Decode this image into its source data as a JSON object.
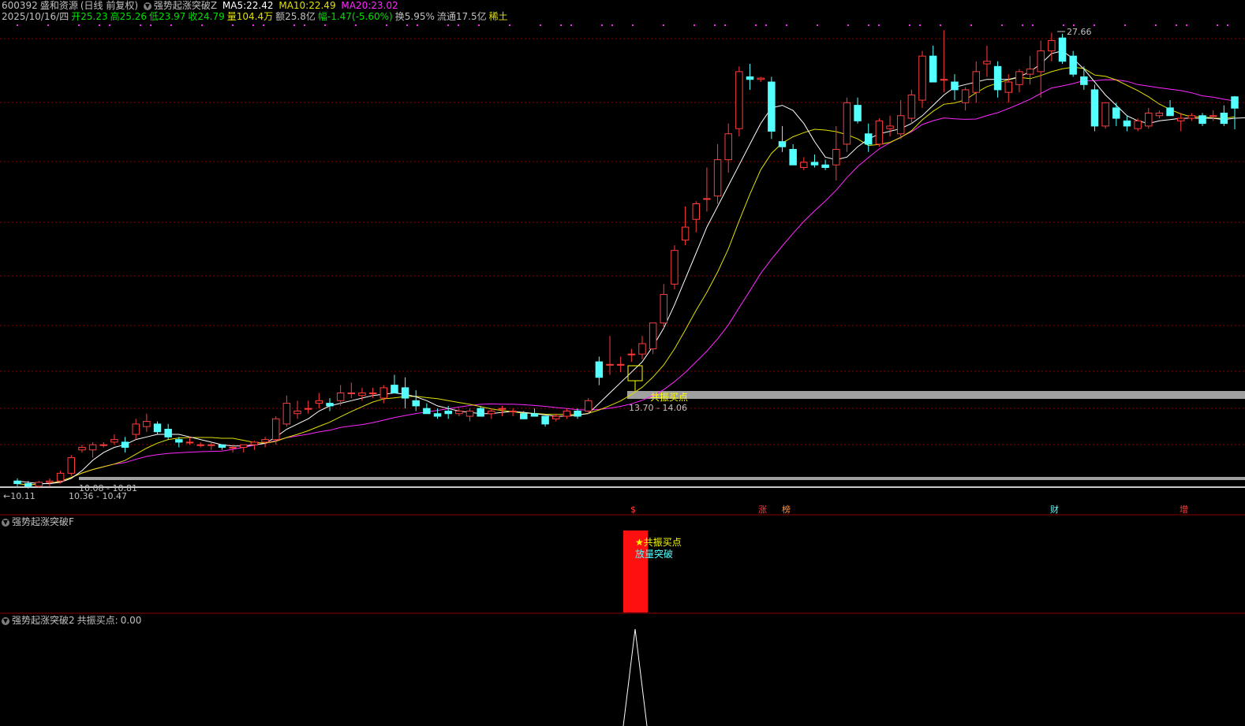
{
  "header": {
    "code": "600392",
    "name": "盛和资源",
    "period": "(日线 前复权)",
    "indicator": "强势起涨突破Z",
    "ma5_label": "MA5:",
    "ma5_value": "22.42",
    "ma10_label": "MA10:",
    "ma10_value": "22.49",
    "ma20_label": "MA20:",
    "ma20_value": "23.02",
    "date": "2025/10/16/四",
    "open_label": "开",
    "open_value": "25.23",
    "high_label": "高",
    "high_value": "25.26",
    "low_label": "低",
    "low_value": "23.97",
    "close_label": "收",
    "close_value": "24.79",
    "vol_label": "量",
    "vol_value": "104.4万",
    "amount_label": "额",
    "amount_value": "25.8亿",
    "amp_label": "幅",
    "amp_value": "-1.47(-5.60%)",
    "turnover_label": "换",
    "turnover_value": "5.95%",
    "float_label": "流通",
    "float_value": "17.5亿",
    "sector": "稀土"
  },
  "colors": {
    "up": "#ff3c3c",
    "down": "#54ffff",
    "ma5": "#ffffff",
    "ma10": "#e0e000",
    "ma20": "#ff28ff",
    "grid": "#8c0000",
    "band": "#a0a0a0"
  },
  "main_labels": {
    "peak": "27.66",
    "left_low": "10.11",
    "range1": "10.08 - 10.81",
    "range2": "10.36 - 10.47",
    "signal": "共振买点",
    "signal_range": "13.70 - 14.06"
  },
  "event_markers": [
    {
      "text": "$",
      "color": "#ff3c3c"
    },
    {
      "text": "涨",
      "color": "#ff3c3c"
    },
    {
      "text": "榜",
      "color": "#ff9040"
    },
    {
      "text": "财",
      "color": "#54ffff"
    },
    {
      "text": "增",
      "color": "#ff3c3c"
    }
  ],
  "panel_f": {
    "title": "强势起涨突破F",
    "signal_label": "★共振买点",
    "signal_label2": "放量突破"
  },
  "panel_2": {
    "title": "强势起涨突破2",
    "value_label": "共振买点:",
    "value": "0.00"
  },
  "chart_data": {
    "type": "candlestick",
    "ohlc": [
      [
        10.4,
        10.5,
        10.2,
        10.3
      ],
      [
        10.3,
        10.4,
        10.11,
        10.2
      ],
      [
        10.2,
        10.4,
        10.15,
        10.35
      ],
      [
        10.35,
        10.5,
        10.2,
        10.4
      ],
      [
        10.4,
        10.8,
        10.3,
        10.7
      ],
      [
        10.7,
        11.4,
        10.6,
        11.3
      ],
      [
        11.6,
        11.8,
        11.5,
        11.7
      ],
      [
        11.6,
        11.9,
        11.3,
        11.8
      ],
      [
        11.8,
        11.9,
        11.7,
        11.8
      ],
      [
        11.9,
        12.2,
        11.8,
        12.0
      ],
      [
        11.9,
        12.1,
        11.5,
        11.7
      ],
      [
        12.2,
        12.8,
        12.0,
        12.6
      ],
      [
        12.5,
        13.0,
        12.3,
        12.7
      ],
      [
        12.6,
        12.7,
        12.2,
        12.3
      ],
      [
        12.4,
        12.6,
        12.0,
        12.1
      ],
      [
        12.0,
        12.1,
        11.7,
        11.9
      ],
      [
        11.9,
        12.1,
        11.8,
        11.9
      ],
      [
        11.8,
        11.9,
        11.7,
        11.8
      ],
      [
        11.8,
        11.9,
        11.6,
        11.8
      ],
      [
        11.8,
        11.8,
        11.6,
        11.7
      ],
      [
        11.7,
        11.8,
        11.5,
        11.7
      ],
      [
        11.7,
        11.8,
        11.5,
        11.8
      ],
      [
        11.8,
        11.95,
        11.6,
        11.9
      ],
      [
        11.9,
        12.1,
        11.7,
        12.0
      ],
      [
        12.0,
        12.9,
        11.8,
        12.8
      ],
      [
        12.6,
        13.7,
        12.5,
        13.4
      ],
      [
        13.0,
        13.5,
        12.8,
        13.1
      ],
      [
        13.2,
        13.5,
        13.0,
        13.2
      ],
      [
        13.4,
        13.8,
        13.2,
        13.5
      ],
      [
        13.4,
        13.6,
        13.1,
        13.3
      ],
      [
        13.5,
        14.1,
        13.3,
        13.8
      ],
      [
        13.8,
        14.2,
        13.6,
        13.8
      ],
      [
        13.7,
        14.0,
        13.5,
        13.8
      ],
      [
        13.8,
        14.0,
        13.6,
        13.8
      ],
      [
        13.6,
        14.1,
        13.4,
        14.0
      ],
      [
        14.1,
        14.5,
        13.8,
        13.8
      ],
      [
        14.0,
        14.4,
        13.2,
        13.6
      ],
      [
        13.5,
        13.9,
        13.1,
        13.3
      ],
      [
        13.2,
        13.4,
        13.0,
        13.0
      ],
      [
        13.0,
        13.2,
        12.8,
        12.9
      ],
      [
        13.1,
        13.3,
        12.8,
        13.0
      ],
      [
        13.0,
        13.2,
        12.9,
        13.1
      ],
      [
        12.9,
        13.2,
        12.7,
        13.1
      ],
      [
        13.2,
        13.3,
        12.9,
        12.9
      ],
      [
        13.0,
        13.2,
        12.8,
        13.1
      ],
      [
        13.2,
        13.3,
        12.9,
        13.2
      ],
      [
        13.1,
        13.2,
        12.9,
        13.1
      ],
      [
        13.0,
        13.1,
        12.8,
        12.8
      ],
      [
        13.0,
        13.2,
        12.9,
        12.9
      ],
      [
        12.9,
        12.9,
        12.5,
        12.6
      ],
      [
        12.8,
        13.0,
        12.7,
        12.9
      ],
      [
        12.9,
        13.2,
        12.8,
        13.1
      ],
      [
        13.1,
        13.2,
        12.8,
        12.9
      ],
      [
        13.1,
        13.6,
        13.0,
        13.5
      ],
      [
        15.0,
        15.2,
        14.1,
        14.4
      ],
      [
        14.9,
        16.0,
        14.5,
        14.9
      ],
      [
        14.9,
        15.2,
        14.6,
        14.9
      ],
      [
        15.3,
        15.5,
        15.0,
        15.3
      ],
      [
        15.3,
        16.0,
        15.1,
        15.7
      ],
      [
        15.5,
        16.5,
        15.3,
        16.5
      ],
      [
        16.5,
        18.0,
        16.3,
        17.6
      ],
      [
        18.0,
        19.5,
        17.8,
        19.3
      ],
      [
        19.7,
        21.0,
        19.5,
        20.2
      ],
      [
        20.5,
        21.2,
        20.0,
        21.1
      ],
      [
        21.3,
        22.5,
        20.8,
        21.3
      ],
      [
        21.4,
        23.4,
        21.1,
        22.8
      ],
      [
        22.8,
        24.2,
        22.3,
        23.8
      ],
      [
        24.0,
        26.4,
        23.7,
        26.2
      ],
      [
        26.0,
        26.5,
        25.5,
        25.9
      ],
      [
        25.9,
        26.0,
        25.8,
        25.95
      ],
      [
        25.8,
        26.0,
        23.6,
        23.9
      ],
      [
        23.5,
        24.1,
        23.1,
        23.3
      ],
      [
        23.2,
        23.4,
        22.6,
        22.6
      ],
      [
        22.5,
        22.9,
        22.4,
        22.7
      ],
      [
        22.7,
        23.0,
        22.5,
        22.6
      ],
      [
        22.6,
        22.8,
        22.4,
        22.5
      ],
      [
        22.6,
        24.1,
        22.0,
        23.2
      ],
      [
        23.4,
        25.2,
        23.1,
        25.0
      ],
      [
        24.9,
        25.2,
        24.2,
        24.3
      ],
      [
        23.8,
        24.2,
        23.1,
        23.4
      ],
      [
        23.4,
        24.4,
        23.3,
        24.3
      ],
      [
        24.0,
        24.5,
        23.7,
        24.1
      ],
      [
        23.8,
        25.1,
        23.6,
        24.5
      ],
      [
        24.4,
        25.5,
        24.2,
        25.3
      ],
      [
        25.1,
        27.0,
        24.8,
        26.8
      ],
      [
        26.8,
        27.2,
        25.8,
        25.8
      ],
      [
        25.9,
        27.8,
        25.4,
        25.9
      ],
      [
        25.8,
        26.1,
        25.1,
        25.5
      ],
      [
        25.0,
        25.6,
        24.7,
        25.5
      ],
      [
        25.4,
        26.6,
        25.0,
        26.2
      ],
      [
        26.5,
        27.2,
        26.0,
        26.6
      ],
      [
        26.4,
        26.6,
        25.2,
        25.5
      ],
      [
        25.4,
        26.1,
        25.0,
        25.8
      ],
      [
        25.7,
        26.3,
        25.4,
        26.2
      ],
      [
        26.1,
        26.8,
        25.7,
        26.3
      ],
      [
        26.2,
        27.4,
        25.2,
        27.0
      ],
      [
        27.0,
        27.7,
        26.6,
        27.4
      ],
      [
        27.5,
        27.66,
        26.5,
        26.6
      ],
      [
        26.8,
        27.0,
        26.0,
        26.1
      ],
      [
        26.0,
        26.4,
        25.5,
        25.7
      ],
      [
        25.5,
        25.7,
        23.9,
        24.1
      ],
      [
        24.1,
        25.0,
        24.0,
        25.0
      ],
      [
        24.8,
        25.0,
        24.1,
        24.4
      ],
      [
        24.3,
        24.5,
        23.9,
        24.1
      ],
      [
        24.0,
        24.4,
        23.9,
        24.3
      ],
      [
        24.1,
        24.8,
        24.0,
        24.6
      ],
      [
        24.5,
        24.7,
        24.4,
        24.6
      ],
      [
        24.8,
        25.1,
        24.5,
        24.5
      ],
      [
        24.3,
        24.6,
        23.9,
        24.4
      ],
      [
        24.4,
        24.6,
        24.3,
        24.5
      ],
      [
        24.5,
        24.6,
        24.1,
        24.2
      ],
      [
        24.5,
        24.7,
        24.3,
        24.5
      ],
      [
        24.6,
        24.9,
        24.1,
        24.2
      ],
      [
        25.23,
        25.26,
        23.97,
        24.79
      ]
    ],
    "ma5": [
      10.4,
      10.35,
      10.3,
      10.3,
      10.35,
      10.5,
      10.8,
      11.2,
      11.5,
      11.7,
      11.8,
      12.0,
      12.1,
      12.2,
      12.2,
      12.2,
      12.1,
      12.0,
      11.9,
      11.8,
      11.75,
      11.75,
      11.8,
      11.85,
      12.1,
      12.4,
      12.6,
      12.8,
      13.1,
      13.3,
      13.4,
      13.5,
      13.6,
      13.7,
      13.75,
      13.8,
      13.75,
      13.65,
      13.5,
      13.3,
      13.2,
      13.1,
      13.05,
      13.0,
      13.0,
      13.05,
      13.08,
      13.05,
      13.0,
      12.95,
      12.9,
      12.9,
      12.95,
      13.0,
      13.4,
      13.8,
      14.2,
      14.6,
      15.0,
      15.6,
      16.3,
      17.2,
      18.2,
      19.2,
      20.2,
      21.0,
      21.8,
      22.6,
      23.4,
      24.2,
      24.8,
      24.9,
      24.7,
      24.2,
      23.5,
      22.9,
      22.8,
      22.9,
      23.3,
      23.6,
      23.8,
      23.9,
      24.0,
      24.2,
      24.5,
      24.9,
      25.3,
      25.6,
      25.7,
      25.8,
      25.9,
      25.9,
      25.9,
      26.0,
      26.2,
      26.5,
      26.9,
      27.0,
      26.7,
      26.3,
      25.8,
      25.3,
      24.9,
      24.5,
      24.3,
      24.2,
      24.3,
      24.35,
      24.4,
      24.4,
      24.4,
      24.4,
      24.35,
      24.4,
      24.42
    ]
  }
}
